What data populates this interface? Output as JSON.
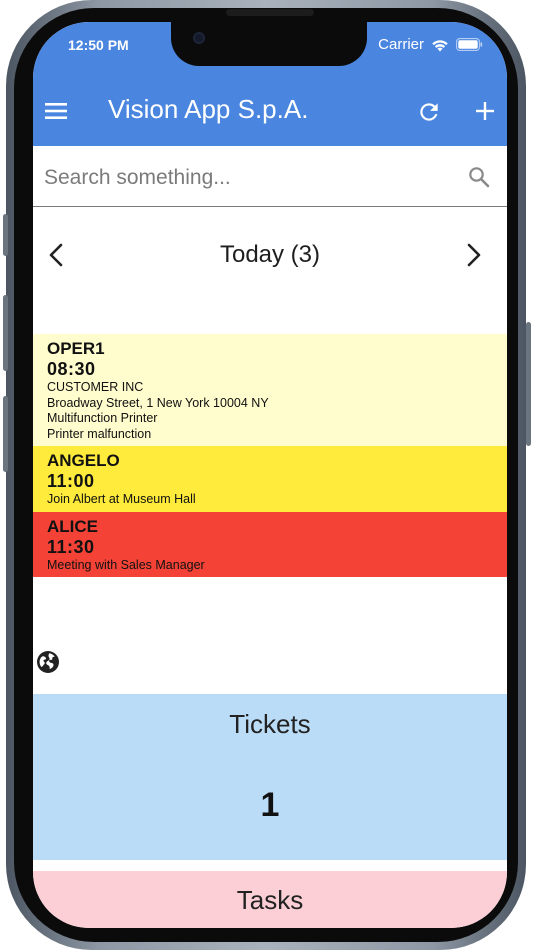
{
  "status_bar": {
    "time": "12:50 PM",
    "carrier": "Carrier"
  },
  "header": {
    "title": "Vision App S.p.A.",
    "color": "#4a86e0"
  },
  "icons": {
    "menu": "menu-icon",
    "refresh": "refresh-icon",
    "add": "plus-icon",
    "search": "search-icon",
    "prev": "chevron-left-icon",
    "next": "chevron-right-icon",
    "globe": "globe-icon"
  },
  "search": {
    "placeholder": "Search something...",
    "value": ""
  },
  "date_nav": {
    "label": "Today (3)"
  },
  "appointments": [
    {
      "operator": "OPER1",
      "time": "08:30",
      "lines": [
        "CUSTOMER INC",
        "Broadway Street, 1 New York 10004 NY",
        "Multifunction Printer",
        "Printer malfunction"
      ],
      "color": "#fffccd"
    },
    {
      "operator": "ANGELO",
      "time": "11:00",
      "lines": [
        "Join Albert at Museum Hall"
      ],
      "color": "#ffeb3b"
    },
    {
      "operator": "ALICE",
      "time": "11:30",
      "lines": [
        "Meeting with Sales Manager"
      ],
      "color": "#f44336"
    }
  ],
  "tickets": {
    "title": "Tickets",
    "count": "1",
    "color": "#bbdcf7"
  },
  "tasks": {
    "title": "Tasks",
    "color": "#fbcfd5"
  }
}
